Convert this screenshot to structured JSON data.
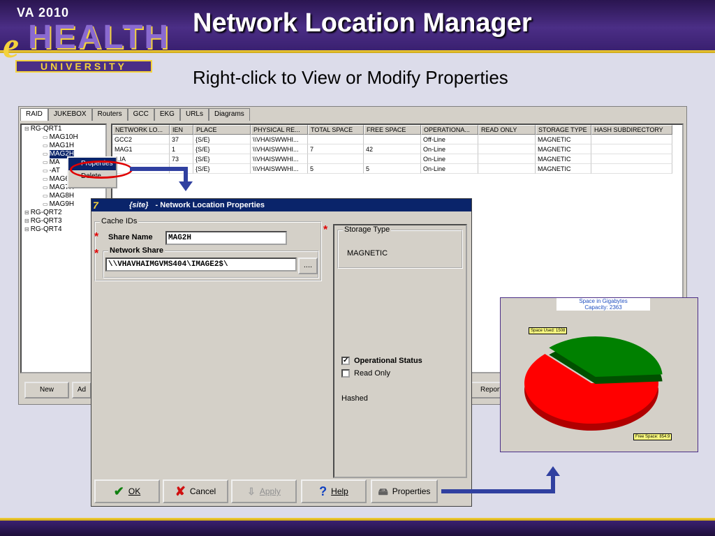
{
  "slide": {
    "title": "Network Location Manager",
    "subtitle": "Right-click to View or Modify Properties",
    "logo": {
      "top": "VA 2010",
      "e": "e",
      "word": "HEALTH",
      "bottom": "UNIVERSITY"
    }
  },
  "app": {
    "tabs": [
      "RAID",
      "JUKEBOX",
      "Routers",
      "GCC",
      "EKG",
      "URLs",
      "Diagrams"
    ],
    "tree": [
      {
        "icon": "net-icon",
        "label": "RG-QRT1",
        "indent": 0
      },
      {
        "icon": "drive-icon",
        "label": "MAG10H",
        "indent": 1
      },
      {
        "icon": "drive-icon",
        "label": "MAG1H",
        "indent": 1
      },
      {
        "icon": "drive-icon",
        "label": "MAG2H",
        "indent": 1,
        "selected": true
      },
      {
        "icon": "drive-icon",
        "label": "MA",
        "indent": 1
      },
      {
        "icon": "drive-icon",
        "label": "-AT",
        "indent": 1
      },
      {
        "icon": "drive-icon",
        "label": "MAG6H",
        "indent": 1
      },
      {
        "icon": "drive-icon",
        "label": "MAG7H",
        "indent": 1
      },
      {
        "icon": "drive-icon",
        "label": "MAG8H",
        "indent": 1
      },
      {
        "icon": "drive-icon",
        "label": "MAG9H",
        "indent": 1
      },
      {
        "icon": "net-icon",
        "label": "RG-QRT2",
        "indent": 0
      },
      {
        "icon": "net-icon",
        "label": "RG-QRT3",
        "indent": 0
      },
      {
        "icon": "net-icon",
        "label": "RG-QRT4",
        "indent": 0
      }
    ],
    "columns": [
      "NETWORK LO...",
      "IEN",
      "PLACE",
      "PHYSICAL RE...",
      "TOTAL SPACE",
      "FREE SPACE",
      "OPERATIONA...",
      "READ ONLY",
      "STORAGE TYPE",
      "HASH SUBDIRECTORY"
    ],
    "rows": [
      [
        "GCC2",
        "37",
        "{S/E}",
        "\\\\VHAISWWHI...",
        "",
        "",
        "Off-Line",
        "",
        "MAGNETIC",
        ""
      ],
      [
        "MAG1",
        "1",
        "{S/E}",
        "\\\\VHAISWWHI...",
        "7",
        "42",
        "On-Line",
        "",
        "MAGNETIC",
        ""
      ],
      [
        "...IA",
        "73",
        "{S/E}",
        "\\\\VHAISWWHI...",
        "",
        "",
        "On-Line",
        "",
        "MAGNETIC",
        ""
      ],
      [
        "",
        "",
        "{S/E}",
        "\\\\VHAISWWHI...",
        "5",
        "5",
        "On-Line",
        "",
        "MAGNETIC",
        ""
      ]
    ],
    "buttons": {
      "new": "New",
      "add": "Ad",
      "report": "Report"
    },
    "context_menu": [
      "Properties",
      "Delete"
    ]
  },
  "dialog": {
    "site": "{site}",
    "title": "- Network Location Properties",
    "cache_ids_label": "Cache IDs",
    "share_name_label": "Share Name",
    "share_name_value": "MAG2H",
    "network_share_label": "Network Share",
    "network_share_value": "\\\\VHAVHAIMGVMS404\\IMAGE2$\\",
    "browse_label": "....",
    "storage_type_label": "Storage Type",
    "storage_type_value": "MAGNETIC",
    "operational_status_label": "Operational Status",
    "operational_status_checked": true,
    "read_only_label": "Read Only",
    "read_only_checked": false,
    "hashed_label": "Hashed",
    "buttons": {
      "ok": {
        "icon": "check-icon",
        "label": "OK"
      },
      "cancel": {
        "icon": "x-icon",
        "label": "Cancel"
      },
      "apply": {
        "icon": "apply-icon",
        "label": "Apply"
      },
      "help": {
        "icon": "help-icon",
        "label": "Help"
      },
      "properties": {
        "icon": "properties-icon",
        "label": "Properties"
      }
    }
  },
  "pie": {
    "title_line1": "Space in Gigabytes",
    "title_line2": "Capacity: 2363",
    "used_label": "Space Used: 1508",
    "free_label": "Free Space: 854.9",
    "used_color": "#ff0000",
    "free_color": "#008000"
  },
  "chart_data": {
    "type": "pie",
    "title": "Space in Gigabytes",
    "subtitle": "Capacity: 2363",
    "categories": [
      "Space Used",
      "Free Space"
    ],
    "values": [
      1508,
      854.9
    ]
  },
  "colors": {
    "accent": "#f4d23c",
    "band": "#4b2e86",
    "arrow": "#3040a0",
    "highlight": "#e00000"
  }
}
